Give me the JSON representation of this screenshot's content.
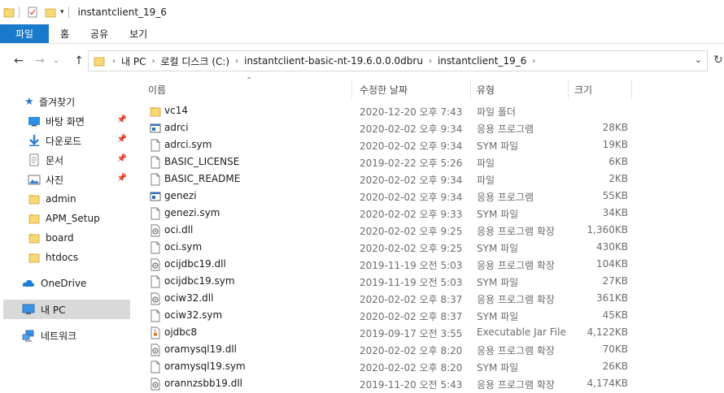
{
  "window": {
    "title": "instantclient_19_6"
  },
  "ribbon": {
    "tabs": [
      "파일",
      "홈",
      "공유",
      "보기"
    ]
  },
  "address": {
    "crumbs": [
      "내 PC",
      "로컬 디스크 (C:)",
      "instantclient-basic-nt-19.6.0.0.0dbru",
      "instantclient_19_6"
    ]
  },
  "sidebar": {
    "items": [
      {
        "label": "즐겨찾기",
        "icon": "star-icon"
      },
      {
        "label": "바탕 화면",
        "icon": "desktop-icon",
        "pinned": true
      },
      {
        "label": "다운로드",
        "icon": "download-icon",
        "pinned": true
      },
      {
        "label": "문서",
        "icon": "document-icon",
        "pinned": true
      },
      {
        "label": "사진",
        "icon": "pictures-icon",
        "pinned": true
      },
      {
        "label": "admin",
        "icon": "folder-icon"
      },
      {
        "label": "APM_Setup",
        "icon": "folder-icon"
      },
      {
        "label": "board",
        "icon": "folder-icon"
      },
      {
        "label": "htdocs",
        "icon": "folder-icon"
      },
      {
        "label": "OneDrive",
        "icon": "cloud-icon"
      },
      {
        "label": "내 PC",
        "icon": "pc-icon",
        "selected": true
      },
      {
        "label": "네트워크",
        "icon": "network-icon"
      }
    ]
  },
  "columns": {
    "name": "이름",
    "date": "수정한 날짜",
    "type": "유형",
    "size": "크기"
  },
  "files": [
    {
      "name": "vc14",
      "date": "2020-12-20 오후 7:43",
      "type": "파일 폴더",
      "size": "",
      "icon": "folder"
    },
    {
      "name": "adrci",
      "date": "2020-02-02 오후 9:34",
      "type": "응용 프로그램",
      "size": "28KB",
      "icon": "app"
    },
    {
      "name": "adrci.sym",
      "date": "2020-02-02 오후 9:34",
      "type": "SYM 파일",
      "size": "19KB",
      "icon": "file"
    },
    {
      "name": "BASIC_LICENSE",
      "date": "2019-02-22 오후 5:26",
      "type": "파일",
      "size": "6KB",
      "icon": "file"
    },
    {
      "name": "BASIC_README",
      "date": "2020-02-02 오후 9:34",
      "type": "파일",
      "size": "2KB",
      "icon": "file"
    },
    {
      "name": "genezi",
      "date": "2020-02-02 오후 9:34",
      "type": "응용 프로그램",
      "size": "55KB",
      "icon": "app"
    },
    {
      "name": "genezi.sym",
      "date": "2020-02-02 오후 9:33",
      "type": "SYM 파일",
      "size": "34KB",
      "icon": "file"
    },
    {
      "name": "oci.dll",
      "date": "2020-02-02 오후 9:25",
      "type": "응용 프로그램 확장",
      "size": "1,360KB",
      "icon": "dll"
    },
    {
      "name": "oci.sym",
      "date": "2020-02-02 오후 9:25",
      "type": "SYM 파일",
      "size": "430KB",
      "icon": "file"
    },
    {
      "name": "ocijdbc19.dll",
      "date": "2019-11-19 오전 5:03",
      "type": "응용 프로그램 확장",
      "size": "104KB",
      "icon": "dll"
    },
    {
      "name": "ocijdbc19.sym",
      "date": "2019-11-19 오전 5:03",
      "type": "SYM 파일",
      "size": "27KB",
      "icon": "file"
    },
    {
      "name": "ociw32.dll",
      "date": "2020-02-02 오후 8:37",
      "type": "응용 프로그램 확장",
      "size": "361KB",
      "icon": "dll"
    },
    {
      "name": "ociw32.sym",
      "date": "2020-02-02 오후 8:37",
      "type": "SYM 파일",
      "size": "45KB",
      "icon": "file"
    },
    {
      "name": "ojdbc8",
      "date": "2019-09-17 오전 3:55",
      "type": "Executable Jar File",
      "size": "4,122KB",
      "icon": "jar"
    },
    {
      "name": "oramysql19.dll",
      "date": "2020-02-02 오후 8:20",
      "type": "응용 프로그램 확장",
      "size": "70KB",
      "icon": "dll"
    },
    {
      "name": "oramysql19.sym",
      "date": "2020-02-02 오후 8:20",
      "type": "SYM 파일",
      "size": "26KB",
      "icon": "file"
    },
    {
      "name": "orannzsbb19.dll",
      "date": "2019-11-20 오전 5:43",
      "type": "응용 프로그램 확장",
      "size": "4,174KB",
      "icon": "dll"
    }
  ],
  "colors": {
    "accent": "#1979ca",
    "folder": "#f8d775",
    "selected": "#d9d9d9"
  }
}
